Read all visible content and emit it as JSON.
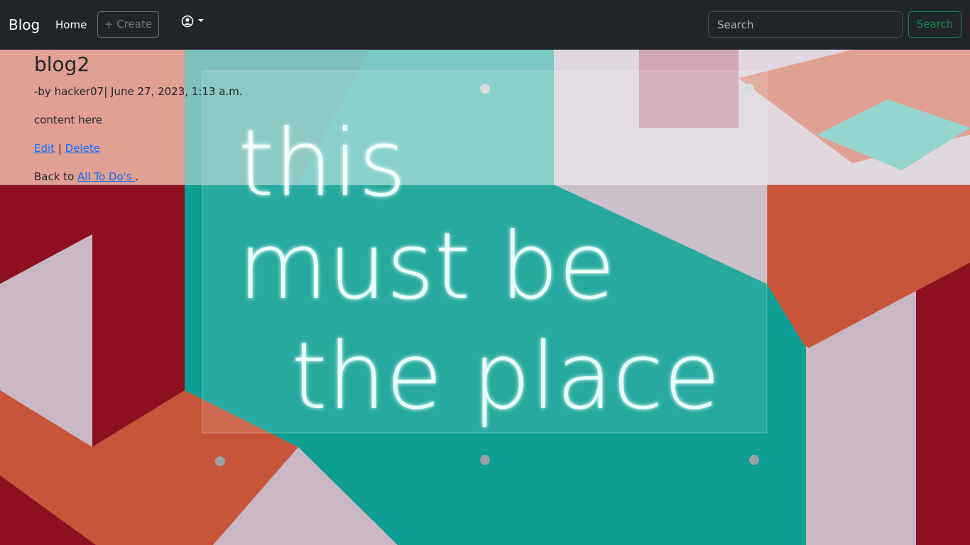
{
  "navbar": {
    "brand": "Blog",
    "home_label": "Home",
    "create_label": "+ Create",
    "user_icon": "user-circle-icon",
    "search_placeholder": "Search",
    "search_value": "",
    "search_button_label": "Search"
  },
  "post": {
    "title": "blog2",
    "meta_prefix": "-by ",
    "author": "hacker07",
    "meta_separator": "| ",
    "date": "June 27, 2023, 1:13 a.m.",
    "content": "content here",
    "edit_label": "Edit",
    "actions_separator": " | ",
    "delete_label": "Delete",
    "back_prefix": "Back to ",
    "back_link_label": "All To Do's ",
    "back_suffix": "."
  },
  "background": {
    "sign_lines": [
      "this",
      "must be",
      "the place"
    ],
    "colors": {
      "teal": "#0e9e93",
      "red": "#8e0f1f",
      "orange": "#c8553a",
      "lavender": "#c9b7c4",
      "neon": "#e9fffb"
    }
  }
}
